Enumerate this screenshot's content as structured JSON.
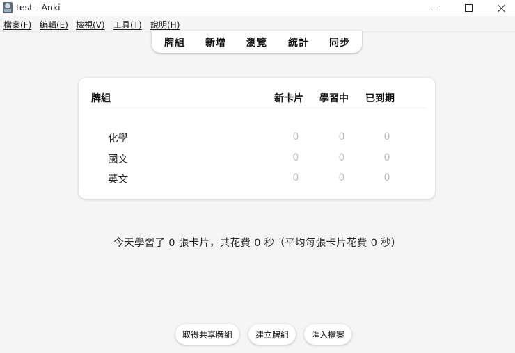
{
  "window": {
    "title": "test - Anki",
    "icon": "anki-app-icon"
  },
  "menu": {
    "items": [
      {
        "label": "檔案(F)"
      },
      {
        "label": "編輯(E)"
      },
      {
        "label": "檢視(V)"
      },
      {
        "label": "工具(T)"
      },
      {
        "label": "說明(H)"
      }
    ]
  },
  "toolbar": {
    "items": [
      {
        "label": "牌組"
      },
      {
        "label": "新增"
      },
      {
        "label": "瀏覽"
      },
      {
        "label": "統計"
      },
      {
        "label": "同步"
      }
    ]
  },
  "decks": {
    "headers": {
      "deck": "牌組",
      "new": "新卡片",
      "learning": "學習中",
      "due": "已到期"
    },
    "rows": [
      {
        "name": "化學",
        "new": "0",
        "learning": "0",
        "due": "0"
      },
      {
        "name": "國文",
        "new": "0",
        "learning": "0",
        "due": "0"
      },
      {
        "name": "英文",
        "new": "0",
        "learning": "0",
        "due": "0"
      }
    ]
  },
  "stats": {
    "text": "今天學習了 0 張卡片，共花費 0 秒（平均每張卡片花費 0 秒）"
  },
  "bottom_buttons": {
    "get_shared": "取得共享牌組",
    "create_deck": "建立牌組",
    "import_file": "匯入檔案"
  },
  "colors": {
    "background": "#f5f5f5",
    "card": "#ffffff",
    "count_zero": "#bdbdbd"
  }
}
